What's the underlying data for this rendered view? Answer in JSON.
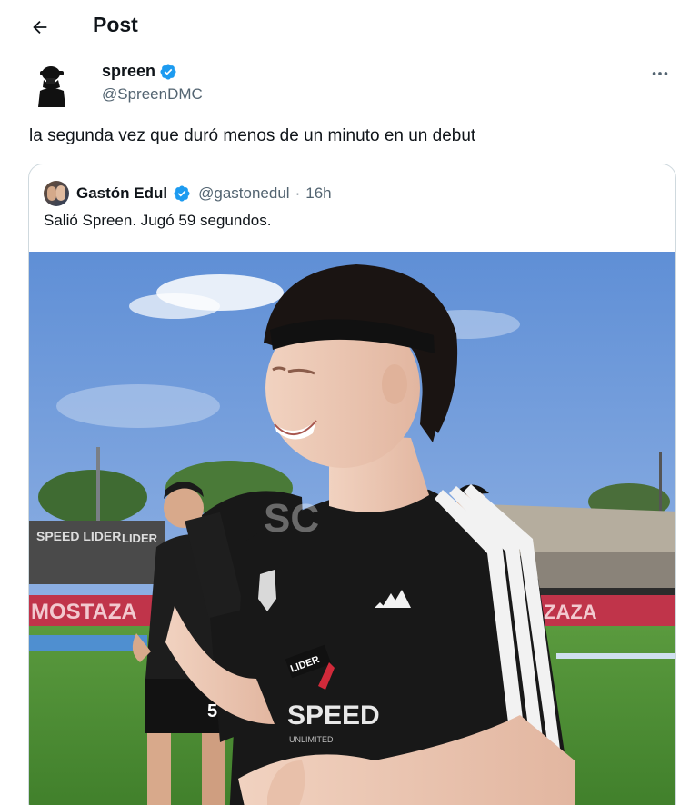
{
  "header": {
    "title": "Post",
    "back_icon": "arrow-left-icon"
  },
  "post": {
    "author_name": "spreen",
    "author_handle": "@SpreenDMC",
    "verified": true,
    "text": "la segunda vez que duró menos de un minuto en un debut",
    "more_icon": "more-horizontal-icon"
  },
  "quote": {
    "author_name": "Gastón Edul",
    "author_handle": "@gastonedul",
    "separator": "·",
    "time": "16h",
    "text": "Salió Spreen. Jugó 59 segundos.",
    "verified": true
  },
  "photo": {
    "banner_left": "MOSTAZA",
    "banner_right": "ZAZA",
    "board_left": "SPEED LIDER",
    "board_right": "LIDER",
    "shirt_sponsor_top": "LIDER",
    "shirt_sponsor_main": "SPEED",
    "shirt_sponsor_bottom": "UNLIMITED",
    "player_number": "5",
    "watermark": "SC"
  },
  "colors": {
    "accent": "#1d9bf0",
    "text_primary": "#0f1419",
    "text_secondary": "#536471",
    "border": "#cfd9de"
  }
}
